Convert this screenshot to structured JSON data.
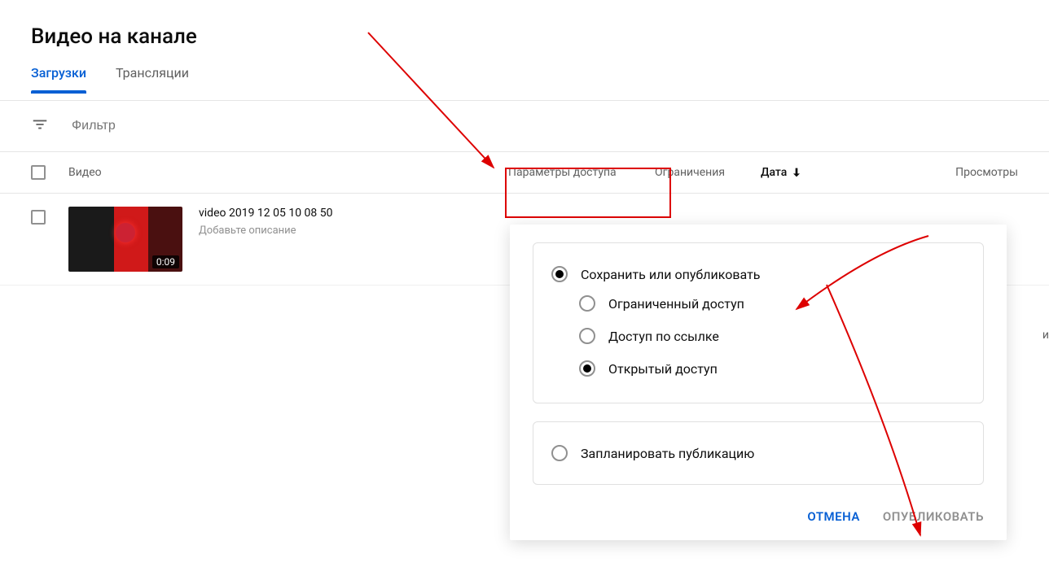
{
  "page": {
    "title": "Видео на канале"
  },
  "tabs": [
    {
      "label": "Загрузки",
      "active": true
    },
    {
      "label": "Трансляции",
      "active": false
    }
  ],
  "filter": {
    "placeholder": "Фильтр"
  },
  "columns": {
    "video": "Видео",
    "access": "Параметры доступа",
    "restrict": "Ограничения",
    "date": "Дата",
    "views": "Просмотры"
  },
  "videos": [
    {
      "title": "video 2019 12 05 10 08 50",
      "description": "Добавьте описание",
      "duration": "0:09"
    }
  ],
  "popup": {
    "group1": {
      "label": "Сохранить или опубликовать",
      "options": [
        {
          "label": "Ограниченный доступ",
          "selected": false
        },
        {
          "label": "Доступ по ссылке",
          "selected": false
        },
        {
          "label": "Открытый доступ",
          "selected": true
        }
      ]
    },
    "group2": {
      "label": "Запланировать публикацию"
    },
    "actions": {
      "cancel": "ОТМЕНА",
      "publish": "ОПУБЛИКОВАТЬ"
    }
  },
  "edge": "и"
}
